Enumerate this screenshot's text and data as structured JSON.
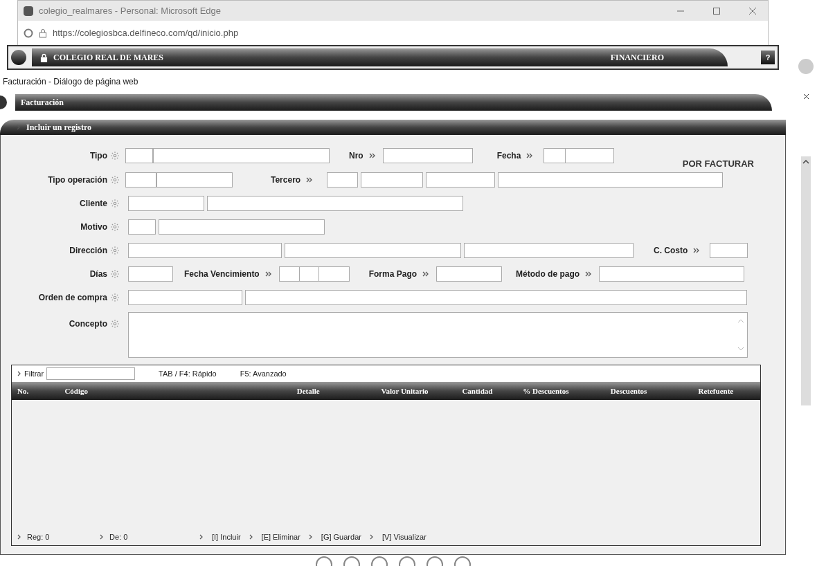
{
  "browser": {
    "title": "colegio_realmares - Personal: Microsoft Edge",
    "url": "https://colegiosbca.delfineco.com/qd/inicio.php"
  },
  "app_header": {
    "title": "COLEGIO REAL DE MARES",
    "module": "FINANCIERO",
    "help": "?"
  },
  "dialog": {
    "title": "Facturación - Diálogo de página web",
    "section": "Facturación",
    "subsection": "Incluir un registro"
  },
  "form": {
    "tipo": "Tipo",
    "nro": "Nro",
    "fecha": "Fecha",
    "status": "POR FACTURAR",
    "tipo_operacion": "Tipo operación",
    "tercero": "Tercero",
    "cliente": "Cliente",
    "motivo": "Motivo",
    "direccion": "Dirección",
    "c_costo": "C. Costo",
    "dias": "Días",
    "fecha_vencimiento": "Fecha Vencimiento",
    "forma_pago": "Forma Pago",
    "metodo_pago": "Método de pago",
    "orden_compra": "Orden de compra",
    "concepto": "Concepto"
  },
  "grid": {
    "filter_label": "Filtrar",
    "hints": [
      "TAB / F4: Rápido",
      "F5: Avanzado"
    ],
    "columns": [
      "No.",
      "Código",
      "Detalle",
      "Valor Unitario",
      "Cantidad",
      "% Descuentos",
      "Descuentos",
      "Retefuente"
    ],
    "counters": [
      "Reg: 0",
      "De: 0"
    ],
    "actions": [
      "[I] Incluir",
      "[E] Eliminar",
      "[G] Guardar",
      "[V] Visualizar"
    ]
  }
}
